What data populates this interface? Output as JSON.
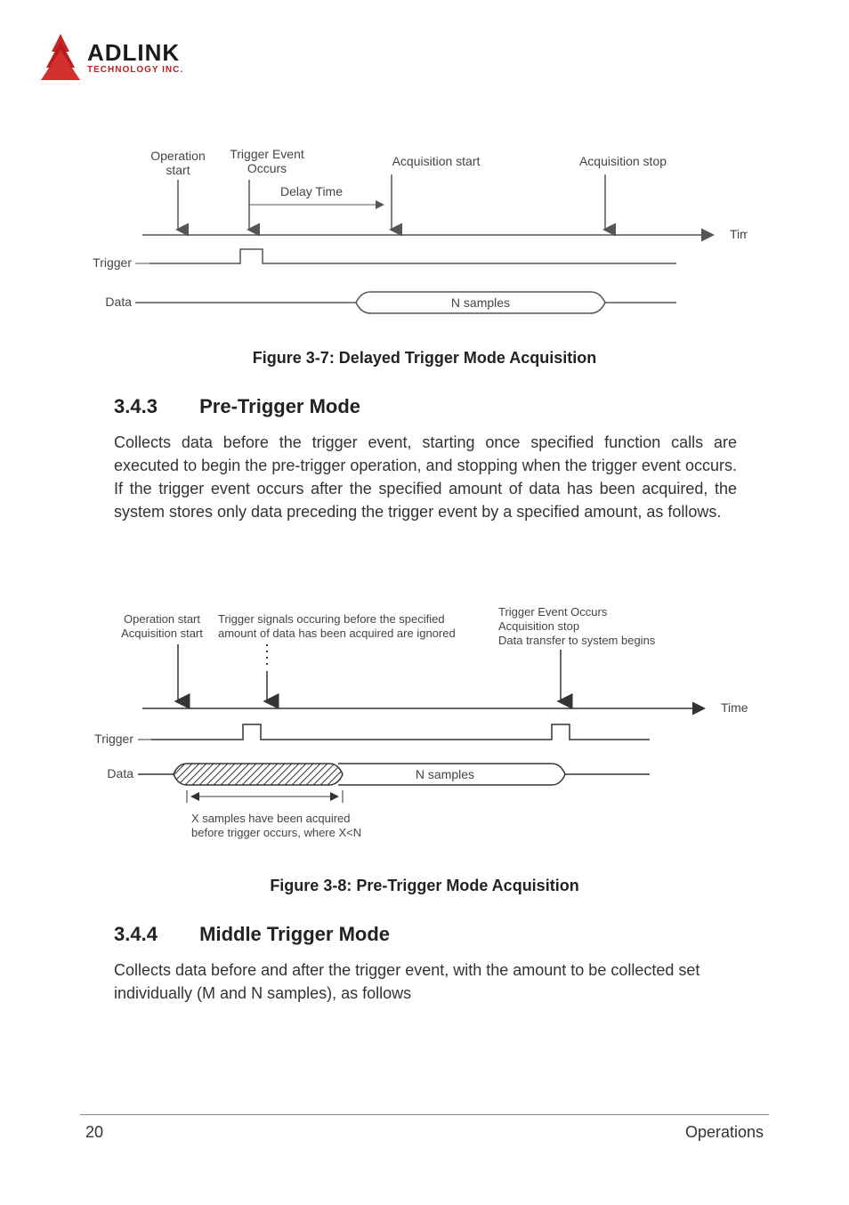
{
  "logo": {
    "primary": "ADLINK",
    "secondary": "TECHNOLOGY INC."
  },
  "figures": {
    "fig37": {
      "caption": "Figure 3-7: Delayed Trigger Mode Acquisition",
      "labels": {
        "op_start_l1": "Operation",
        "op_start_l2": "start",
        "trig_evt_l1": "Trigger Event",
        "trig_evt_l2": "Occurs",
        "delay_time": "Delay Time",
        "acq_start": "Acquisition start",
        "acq_stop": "Acquisition stop",
        "time": "Time",
        "trigger": "Trigger",
        "data": "Data",
        "n_samples": "N samples"
      }
    },
    "fig38": {
      "caption": "Figure 3-8: Pre-Trigger Mode Acquisition",
      "labels": {
        "op_start_l1": "Operation start",
        "op_start_l2": "Acquisition start",
        "ignored_l1": "Trigger signals occuring before the specified",
        "ignored_l2": "amount of data has been acquired are ignored",
        "evt_l1": "Trigger Event Occurs",
        "evt_l2": "Acquisition stop",
        "evt_l3": "Data transfer to system begins",
        "time": "Time",
        "trigger": "Trigger",
        "data": "Data",
        "n_samples": "N samples",
        "xnote_l1": "X samples have been acquired",
        "xnote_l2": "before trigger occurs, where X<N"
      }
    }
  },
  "sections": {
    "s343": {
      "num": "3.4.3",
      "title": "Pre-Trigger Mode",
      "body": "Collects data before the trigger event, starting once specified function calls are executed to begin the pre-trigger operation, and stopping when the trigger event occurs. If the trigger event occurs after the specified amount of data has been acquired, the system stores only data preceding the trigger event by a specified amount, as follows."
    },
    "s344": {
      "num": "3.4.4",
      "title": "Middle Trigger Mode",
      "body": "Collects data before and after the trigger event, with the amount to be collected set individually (M and N samples), as follows"
    }
  },
  "footer": {
    "page": "20",
    "section": "Operations"
  }
}
